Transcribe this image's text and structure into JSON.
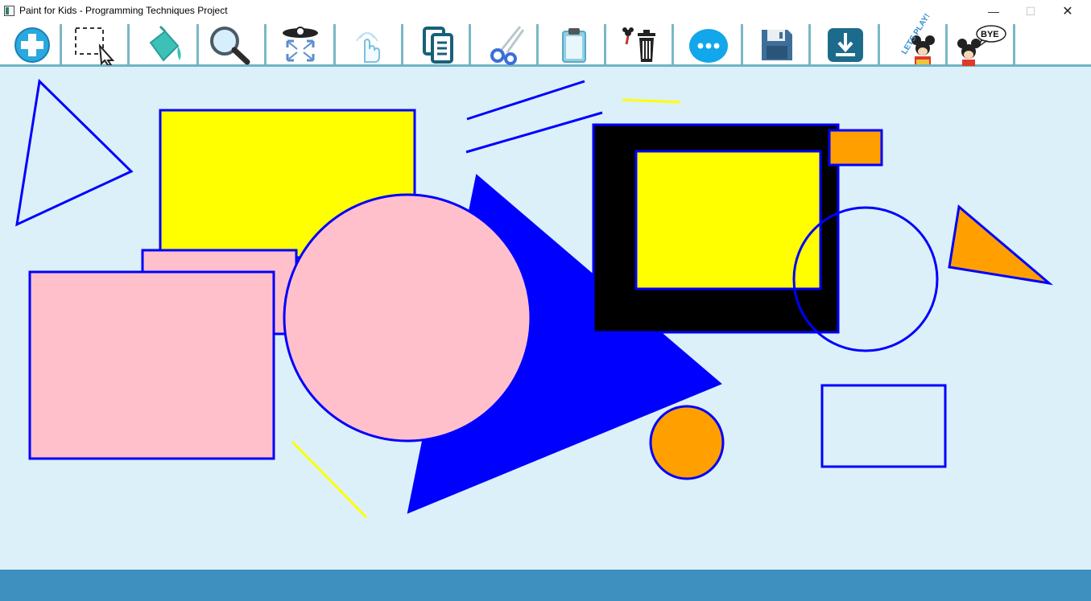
{
  "window": {
    "title": "Paint for Kids - Programming Techniques Project",
    "controls": {
      "minimize": "—",
      "maximize": "☐",
      "close": "✕"
    }
  },
  "toolbar": {
    "tools": [
      {
        "icon": "add-figure-icon"
      },
      {
        "icon": "select-icon"
      },
      {
        "icon": "fill-bucket-icon"
      },
      {
        "icon": "zoom-icon"
      },
      {
        "icon": "resize-icon"
      },
      {
        "icon": "hand-move-icon"
      },
      {
        "icon": "copy-icon"
      },
      {
        "icon": "cut-icon"
      },
      {
        "icon": "paste-icon"
      },
      {
        "icon": "delete-icon"
      },
      {
        "icon": "more-icon"
      },
      {
        "icon": "save-icon"
      },
      {
        "icon": "load-icon"
      },
      {
        "icon": "play-mode-icon",
        "label": "LETS PLAY!"
      },
      {
        "icon": "exit-icon",
        "label": "BYE"
      }
    ]
  },
  "canvas": {
    "background": "#dcf0f9",
    "figures": [
      {
        "type": "triangle",
        "name": "outline-triangle",
        "fill": "none",
        "stroke": "#0000ff"
      },
      {
        "type": "rectangle",
        "name": "yellow-rectangle",
        "fill": "#ffff00",
        "stroke": "#0000ff"
      },
      {
        "type": "rectangle",
        "name": "pink-rectangle-back",
        "fill": "#ffc0cb",
        "stroke": "#0000ff"
      },
      {
        "type": "rectangle",
        "name": "pink-rectangle-front",
        "fill": "#ffc0cb",
        "stroke": "#0000ff"
      },
      {
        "type": "line",
        "name": "blue-line-top",
        "stroke": "#0000ff"
      },
      {
        "type": "line",
        "name": "blue-line-bottom",
        "stroke": "#0000ff"
      },
      {
        "type": "line",
        "name": "yellow-line-top",
        "stroke": "#ffff00"
      },
      {
        "type": "triangle",
        "name": "blue-filled-triangle",
        "fill": "#0000ff",
        "stroke": "#0000ff"
      },
      {
        "type": "circle",
        "name": "pink-circle",
        "fill": "#ffc0cb",
        "stroke": "#0000ff"
      },
      {
        "type": "rectangle",
        "name": "black-rectangle",
        "fill": "#000000",
        "stroke": "#0000ff"
      },
      {
        "type": "rectangle",
        "name": "inner-yellow-rectangle",
        "fill": "#ffff00",
        "stroke": "#0000ff"
      },
      {
        "type": "rectangle",
        "name": "small-orange-rectangle",
        "fill": "#ffa000",
        "stroke": "#0000ff"
      },
      {
        "type": "circle",
        "name": "outline-circle",
        "fill": "none",
        "stroke": "#0000ff"
      },
      {
        "type": "triangle",
        "name": "orange-triangle",
        "fill": "#ffa000",
        "stroke": "#0000ff"
      },
      {
        "type": "circle",
        "name": "orange-circle",
        "fill": "#ffa000",
        "stroke": "#0000ff"
      },
      {
        "type": "rectangle",
        "name": "outline-rectangle",
        "fill": "none",
        "stroke": "#0000ff"
      },
      {
        "type": "line",
        "name": "yellow-line-bottom",
        "stroke": "#ffff00"
      }
    ]
  },
  "statusbar": {
    "background": "#3e90be",
    "text": ""
  }
}
